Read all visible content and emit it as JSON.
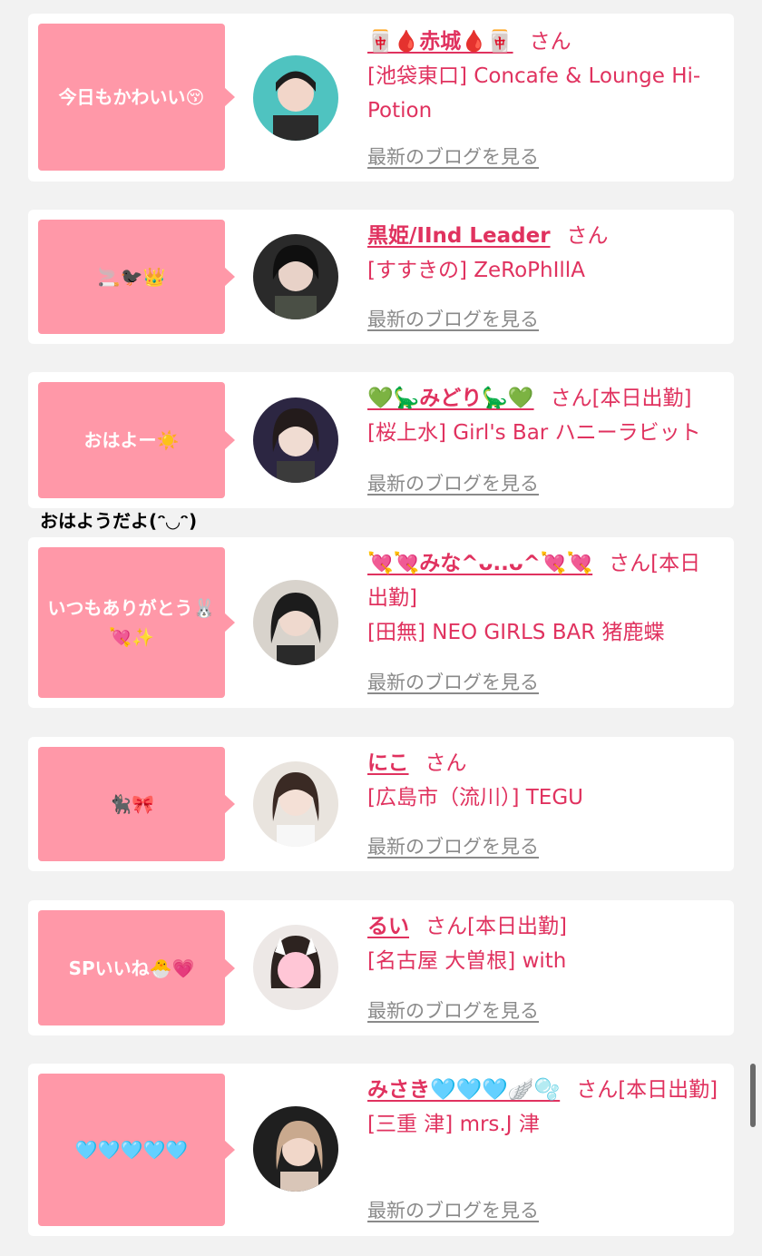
{
  "blog_link_label": "最新のブログを見る",
  "caption": "おはようだよ(ᵔ◡ᵔ)",
  "cards": [
    {
      "bubble": "今日もかわいい😚",
      "name": "🀄🩸赤城🩸🀄",
      "honorific": "さん",
      "shop": "[池袋東口] Concafe & Lounge Hi-Potion"
    },
    {
      "bubble": "🚬🐦‍⬛👑",
      "name": "黒姫/IInd Leader",
      "honorific": "さん",
      "shop": "[すすきの] ZeRoPhIllA"
    },
    {
      "bubble": "おはよー☀️",
      "name": "💚🦕みどり🦕💚",
      "honorific": "さん[本日出勤]",
      "shop": "[桜上水] Girl's Bar ハニーラビット"
    },
    {
      "bubble": "いつもありがとう🐰💘✨",
      "name": "💘💘みな^ᴗ..ᴗ^💘💘",
      "honorific": "さん[本日出勤]",
      "shop": "[田無] NEO GIRLS BAR 猪鹿蝶"
    },
    {
      "bubble": "🐈‍⬛🎀",
      "name": "にこ",
      "honorific": "さん",
      "shop": "[広島市（流川）] TEGU"
    },
    {
      "bubble": "SPいいね🐣💗",
      "name": "るい",
      "honorific": "さん[本日出勤]",
      "shop": "[名古屋 大曽根] with"
    },
    {
      "bubble": "🩵🩵🩵🩵🩵",
      "name": "みさき🩵🩵🩵🪽🫧",
      "honorific": "さん[本日出勤]",
      "shop": "[三重 津] mrs.J 津"
    }
  ]
}
